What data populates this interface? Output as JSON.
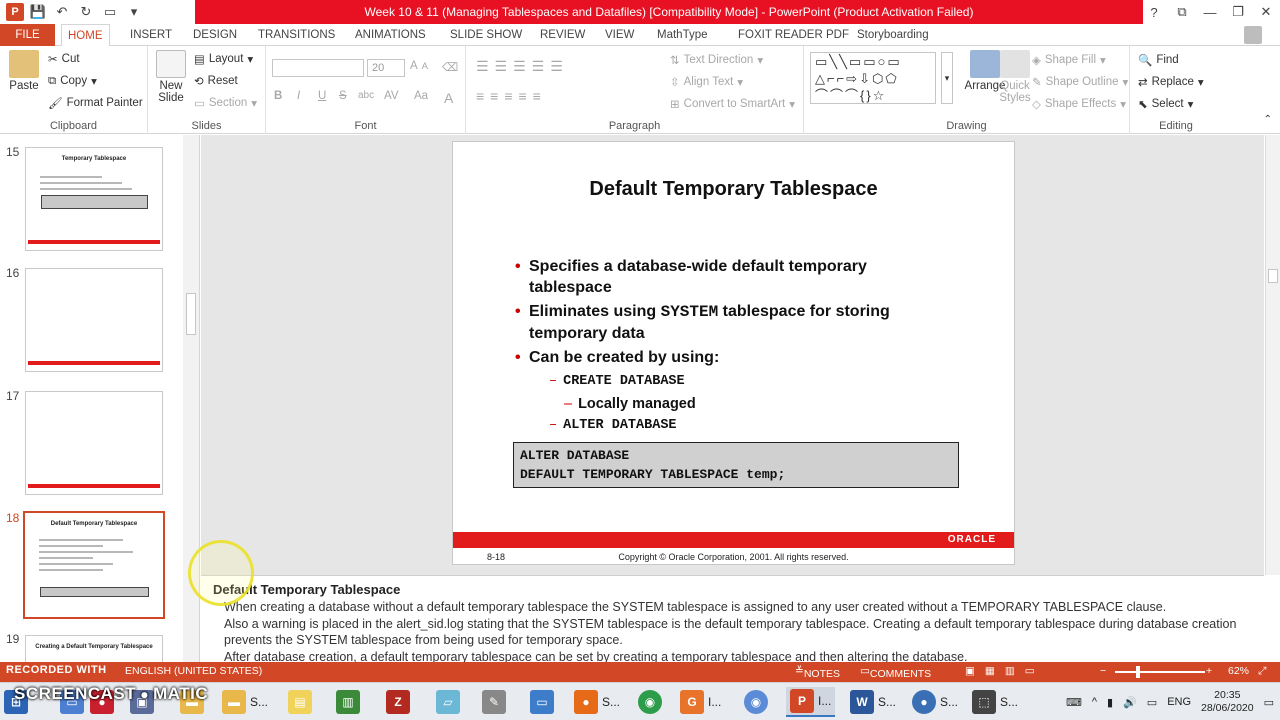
{
  "window": {
    "title": "Week 10 & 11 (Managing Tablespaces and Datafiles) [Compatibility Mode] -  PowerPoint (Product Activation Failed)",
    "title_bar_color": "#e81123",
    "controls": [
      "?",
      "⧉",
      "—",
      "❐",
      "✕"
    ]
  },
  "tabs": [
    "FILE",
    "HOME",
    "INSERT",
    "DESIGN",
    "TRANSITIONS",
    "ANIMATIONS",
    "SLIDE SHOW",
    "REVIEW",
    "VIEW",
    "MathType",
    "FOXIT READER PDF",
    "Storyboarding"
  ],
  "active_tab": "HOME",
  "ribbon": {
    "clipboard": {
      "paste": "Paste",
      "cut": "Cut",
      "copy": "Copy",
      "format_painter": "Format Painter",
      "label": "Clipboard"
    },
    "slides": {
      "new_slide": "New",
      "new_slide2": "Slide",
      "layout": "Layout",
      "reset": "Reset",
      "section": "Section",
      "label": "Slides"
    },
    "font": {
      "size": "20",
      "bold": "B",
      "italic": "I",
      "underline": "U",
      "strike": "S",
      "abc": "abc",
      "av": "AV",
      "aa": "Aa",
      "a": "A",
      "label": "Font"
    },
    "paragraph": {
      "text_direction": "Text Direction",
      "align_text": "Align Text",
      "convert_smartart": "Convert to SmartArt",
      "label": "Paragraph"
    },
    "drawing": {
      "arrange": "Arrange",
      "quick_styles": "Quick",
      "quick_styles2": "Styles",
      "shape_fill": "Shape Fill",
      "shape_outline": "Shape Outline",
      "shape_effects": "Shape Effects",
      "label": "Drawing"
    },
    "editing": {
      "find": "Find",
      "replace": "Replace",
      "select": "Select",
      "label": "Editing"
    }
  },
  "thumbnails": [
    {
      "num": "15",
      "title": "Temporary Tablespace"
    },
    {
      "num": "16"
    },
    {
      "num": "17"
    },
    {
      "num": "18",
      "title": "Default Temporary Tablespace"
    },
    {
      "num": "19",
      "title": "Creating a Default Temporary Tablespace"
    }
  ],
  "slide": {
    "title": "Default Temporary Tablespace",
    "b1": "Specifies a database-wide default temporary tablespace",
    "b2_pre": "Eliminates using ",
    "b2_code": "SYSTEM",
    "b2_post": " tablespace for storing temporary data",
    "b3": "Can be created by using:",
    "sub1": "CREATE DATABASE",
    "sub1a": "Locally managed",
    "sub2": "ALTER DATABASE",
    "code_line1": "ALTER DATABASE",
    "code_line2": "DEFAULT TEMPORARY TABLESPACE temp;",
    "logo": "ORACLE",
    "footer_num": "8-18",
    "copyright": "Copyright © Oracle Corporation, 2001. All rights reserved.",
    "accent": "#e21b1b"
  },
  "notes": {
    "title": "Default Temporary Tablespace",
    "p1": "When creating a database without a default temporary tablespace the SYSTEM tablespace is assigned to any user created without a TEMPORARY TABLESPACE clause.",
    "p2": "Also a warning is placed in the alert_sid.log stating that the SYSTEM tablespace is the default temporary tablespace. Creating a default temporary tablespace during database creation prevents the SYSTEM tablespace from being used for temporary space.",
    "p3": "After database creation, a default temporary tablespace can be set by creating a temporary tablespace and then altering the database."
  },
  "statusbar": {
    "language": "ENGLISH (UNITED STATES)",
    "notes": "NOTES",
    "comments": "COMMENTS",
    "zoom": "62%",
    "color": "#d24726"
  },
  "watermark": {
    "line1": "RECORDED WITH",
    "line2": "SCREENCAST",
    "line3": "MATIC"
  },
  "taskbar": {
    "items": [
      "S...",
      "S...",
      "I...",
      "I...",
      "S...",
      "S..."
    ],
    "lang": "ENG",
    "time": "20:35",
    "date": "28/06/2020"
  }
}
